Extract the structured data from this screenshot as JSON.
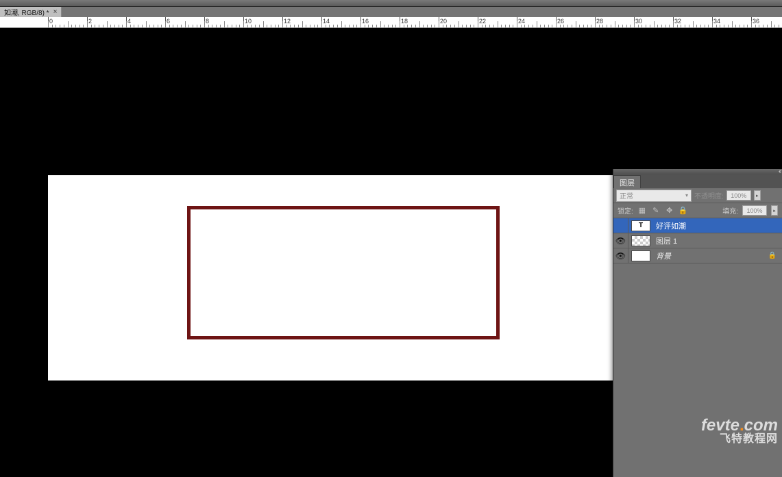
{
  "document_tab": {
    "title": "如潮, RGB/8) *",
    "close": "×"
  },
  "ruler": {
    "ticks": [
      0,
      2,
      4,
      6,
      8,
      10,
      12,
      14,
      16,
      18,
      20,
      22,
      24,
      26,
      28,
      30,
      32,
      34,
      36
    ]
  },
  "layers_panel": {
    "tab_label": "图层",
    "blend_mode": "正常",
    "opacity_label": "不透明度:",
    "opacity_value": "100%",
    "lock_label": "锁定:",
    "fill_label": "填充:",
    "fill_value": "100%",
    "layers": [
      {
        "visible": false,
        "type": "text",
        "name": "好评如潮",
        "selected": true,
        "locked": false
      },
      {
        "visible": true,
        "type": "raster",
        "name": "图层 1",
        "selected": false,
        "locked": false
      },
      {
        "visible": true,
        "type": "background",
        "name": "背景",
        "selected": false,
        "locked": true
      }
    ]
  },
  "watermark": {
    "brand": "fevte",
    "tld": "com",
    "subtitle": "飞特教程网"
  }
}
